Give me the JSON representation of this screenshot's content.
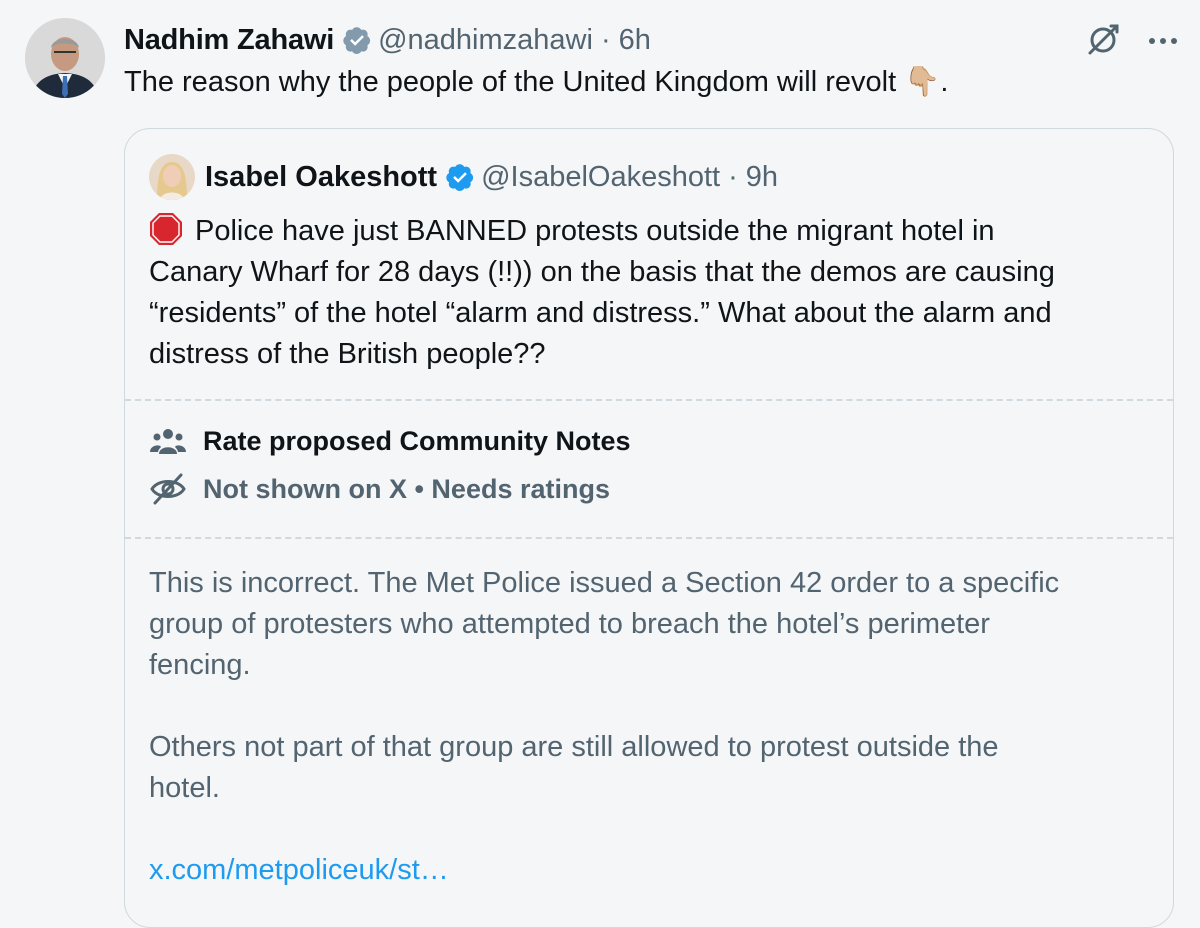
{
  "tweet": {
    "author_name": "Nadhim Zahawi",
    "handle": "@nadhimzahawi",
    "separator": "·",
    "time": "6h",
    "text": "The reason why the people of the United Kingdom will revolt",
    "emoji": "👇🏼",
    "text_end": "."
  },
  "icons": {
    "top_right": [
      "grok-icon",
      "more-icon"
    ],
    "verified_color": "#1d9bf0"
  },
  "quote": {
    "author_name": "Isabel Oakeshott",
    "handle": "@IsabelOakeshott",
    "separator": "·",
    "time": "9h",
    "text_lines": [
      "Police have just BANNED protests outside the migrant hotel in",
      "Canary Wharf for 28 days (!!)) on the basis that the demos are causing",
      "“residents” of the hotel “alarm and distress.”  What about the alarm and",
      "distress of the British people??"
    ]
  },
  "community_notes": {
    "rate_label": "Rate proposed Community Notes",
    "status_label": "Not shown on X • Needs ratings"
  },
  "note": {
    "paragraph1_lines": [
      "This is incorrect. The Met Police issued a Section 42 order to a specific",
      "group of protesters who attempted to breach the hotel’s perimeter",
      "fencing."
    ],
    "paragraph2_lines": [
      "Others not part of that group are still allowed to protest outside the",
      "hotel."
    ],
    "link": "x.com/metpoliceuk/st…"
  }
}
